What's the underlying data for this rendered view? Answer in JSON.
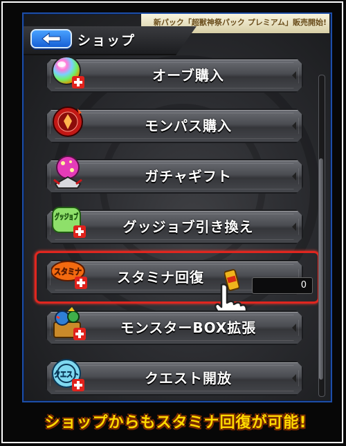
{
  "header": {
    "title": "ショップ",
    "banner": "新パック「超獣神祭パック プレミアム」販売開始!"
  },
  "menu": {
    "items": [
      {
        "label": "オーブ購入",
        "icon": "orb-icon"
      },
      {
        "label": "モンパス購入",
        "icon": "monpass-icon"
      },
      {
        "label": "ガチャギフト",
        "icon": "gacha-gift-icon"
      },
      {
        "label": "グッジョブ引き換え",
        "icon": "goodjob-icon"
      },
      {
        "label": "スタミナ回復",
        "icon": "stamina-icon"
      },
      {
        "label": "モンスターBOX拡張",
        "icon": "monster-box-icon"
      },
      {
        "label": "クエスト開放",
        "icon": "quest-icon"
      }
    ]
  },
  "stamina": {
    "badge_text": "スタミナ",
    "item_count": "0"
  },
  "icon_text": {
    "goodjob": "グッジョブ",
    "quest": "クエスト"
  },
  "caption": "ショップからもスタミナ回復が可能!",
  "colors": {
    "highlight": "#e0261f",
    "caption": "#ffd900",
    "back_button": "#1760d6",
    "plus_badge": "#e0221c"
  }
}
